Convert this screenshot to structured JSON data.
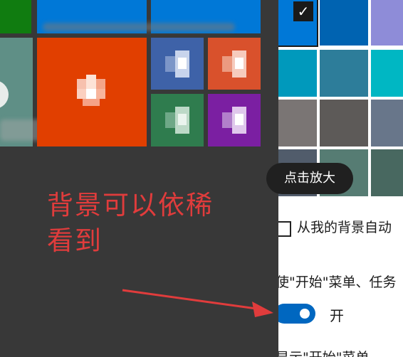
{
  "colors": {
    "start_bg": "#383838",
    "tile_green": "#107c10",
    "tile_blue": "#0078d7",
    "tile_office": "#e13f00",
    "tile_word": "#3e62a8",
    "tile_ppt": "#d9512c",
    "tile_excel": "#2f7c4e",
    "tile_onenote": "#7b1fa2",
    "tile_photo": "#5f8f86",
    "annotation": "#e03c3c",
    "toggle_on": "#0067c0",
    "swatches": [
      [
        "#0078d7",
        "#0063b1",
        "#8e8cd8"
      ],
      [
        "#0099bc",
        "#2d7d9a",
        "#00b7c3"
      ],
      [
        "#7a7574",
        "#5d5a58",
        "#68768a"
      ],
      [
        "#515c6b",
        "#567c73",
        "#486860"
      ]
    ]
  },
  "annotation": {
    "text": "背景可以依稀看到"
  },
  "tooltip": {
    "label": "点击放大"
  },
  "settings": {
    "background_checkbox_label": "从我的背景自动",
    "start_taskbar_label": "使\"开始\"菜单、任务",
    "toggle_state": "开",
    "bottom_label": "显示\"开始\"菜单、"
  }
}
